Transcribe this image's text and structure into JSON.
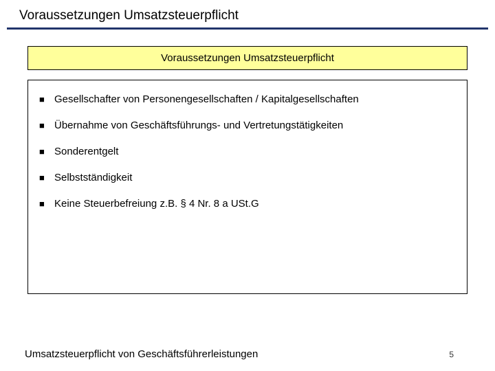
{
  "header": {
    "title": "Voraussetzungen Umsatzsteuerpflicht"
  },
  "subtitle": {
    "text": "Voraussetzungen Umsatzsteuerpflicht"
  },
  "bullets": {
    "items": [
      {
        "text": "Gesellschafter von Personengesellschaften / Kapitalgesellschaften"
      },
      {
        "text": "Übernahme von Geschäftsführungs- und Vertretungstätigkeiten"
      },
      {
        "text": "Sonderentgelt"
      },
      {
        "text": "Selbstständigkeit"
      },
      {
        "text": "Keine Steuerbefreiung z.B. § 4 Nr. 8 a USt.G"
      }
    ]
  },
  "footer": {
    "text": "Umsatzsteuerpflicht von Geschäftsführerleistungen",
    "page": "5"
  }
}
